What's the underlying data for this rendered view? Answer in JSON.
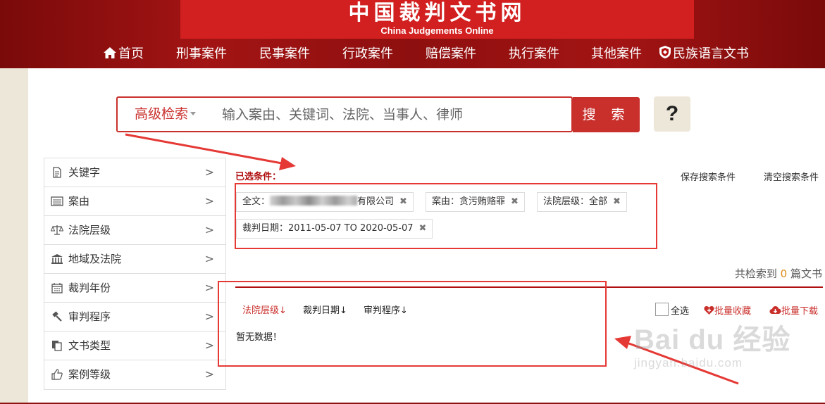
{
  "header": {
    "title": "中国裁判文书网",
    "subtitle": "China Judgements Online",
    "nav": [
      {
        "label": "首页",
        "icon": "home-icon"
      },
      {
        "label": "刑事案件"
      },
      {
        "label": "民事案件"
      },
      {
        "label": "行政案件"
      },
      {
        "label": "赔偿案件"
      },
      {
        "label": "执行案件"
      },
      {
        "label": "其他案件"
      },
      {
        "label": "民族语言文书",
        "icon": "shield-icon"
      }
    ]
  },
  "search": {
    "advanced_label": "高级检索",
    "placeholder": "输入案由、关键词、法院、当事人、律师",
    "button_label": "搜 索",
    "help_label": "?"
  },
  "sidebar": {
    "items": [
      {
        "label": "关键字",
        "icon": "document-icon"
      },
      {
        "label": "案由",
        "icon": "list-icon"
      },
      {
        "label": "法院层级",
        "icon": "scale-icon"
      },
      {
        "label": "地域及法院",
        "icon": "court-building-icon"
      },
      {
        "label": "裁判年份",
        "icon": "calendar-icon"
      },
      {
        "label": "审判程序",
        "icon": "gavel-icon"
      },
      {
        "label": "文书类型",
        "icon": "copy-icon"
      },
      {
        "label": "案例等级",
        "icon": "thumbs-up-icon"
      }
    ],
    "arrow": ">"
  },
  "conditions": {
    "title": "已选条件：",
    "save_label": "保存搜索条件",
    "clear_label": "清空搜索条件",
    "tags": [
      {
        "prefix": "全文：",
        "suffix": "有限公司"
      },
      {
        "text": "案由：贪污贿赂罪"
      },
      {
        "text": "法院层级：全部"
      },
      {
        "text": "裁判日期：2011-05-07 TO 2020-05-07"
      }
    ],
    "close_glyph": "✖"
  },
  "results": {
    "total_prefix": "共检索到",
    "total_count": "0",
    "total_suffix": "篇文书",
    "sorts": [
      {
        "label": "法院层级",
        "arrow": "↓"
      },
      {
        "label": "裁判日期",
        "arrow": "↓"
      },
      {
        "label": "审判程序",
        "arrow": "↓"
      }
    ],
    "select_all_label": "全选",
    "batch_collect_label": "批量收藏",
    "batch_download_label": "批量下载",
    "empty_text": "暂无数据！"
  },
  "watermark": {
    "brand": "Bai du 经验",
    "url": "jingyan.baidu.com"
  },
  "colors": {
    "header_red": "#a31414",
    "accent_red": "#c9302c",
    "annotation_red": "#e53935",
    "count_orange": "#e08a1a",
    "cream": "#ede7d9"
  }
}
